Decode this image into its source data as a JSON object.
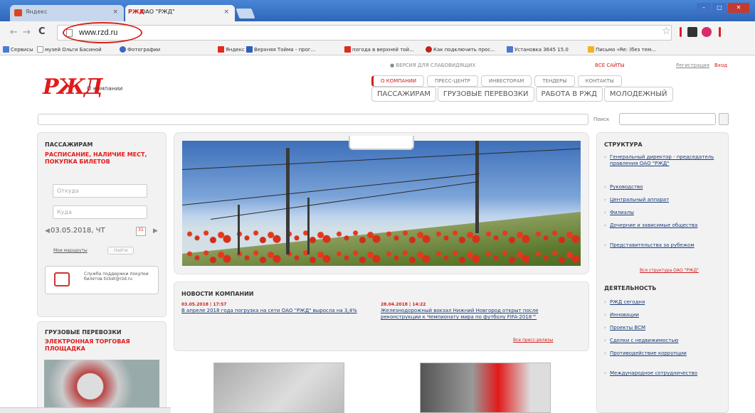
{
  "browser": {
    "tabs": [
      {
        "label": "Яндекс",
        "active": false
      },
      {
        "label": "ОАО \"РЖД\"",
        "favicon_text": "РЖД",
        "active": true
      }
    ],
    "close_glyph": "×",
    "address": "www.rzd.ru",
    "nav": {
      "back": "←",
      "forward": "→",
      "reload": "C"
    },
    "star_glyph": "☆",
    "window_buttons": [
      "–",
      "□",
      "✕"
    ],
    "bookmarks": [
      {
        "label": "Сервисы",
        "color": "#4a7bd0"
      },
      {
        "label": "музей Ольги Басиной",
        "color": "#7aa0d8"
      },
      {
        "label": "Фотографии",
        "color": "#3a67c4"
      },
      {
        "label": "Яндекс",
        "color": "#e02b1c"
      },
      {
        "label": "Верхняя Тойма - прог...",
        "color": "#2f5fb8"
      },
      {
        "label": "погода в верхней той...",
        "color": "#e02b1c"
      },
      {
        "label": "Как подключить прос...",
        "color": "#c4231b"
      },
      {
        "label": "Установка 3645 15.0",
        "color": "#4c79c9"
      },
      {
        "label": "Письмо «Re: (без тем...",
        "color": "#f0b323"
      }
    ]
  },
  "site": {
    "logo_text": "РЖД",
    "logo_subtitle": "О компании",
    "utility": {
      "accessible": "ВЕРСИЯ ДЛЯ СЛАБОВИДЯЩИХ",
      "all_sites": "ВСЕ САЙТЫ",
      "register": "Регистрация",
      "login": "Вход"
    },
    "top_nav": [
      "О КОМПАНИИ",
      "ПРЕСС-ЦЕНТР",
      "ИНВЕСТОРАМ",
      "ТЕНДЕРЫ",
      "КОНТАКТЫ"
    ],
    "main_nav": [
      "ПАССАЖИРАМ",
      "ГРУЗОВЫЕ ПЕРЕВОЗКИ",
      "РАБОТА В РЖД",
      "МОЛОДЕЖНЫЙ"
    ],
    "search_label": "Поиск",
    "passengers": {
      "heading": "ПАССАЖИРАМ",
      "subheading": "РАСПИСАНИЕ, НАЛИЧИЕ МЕСТ, ПОКУПКА БИЛЕТОВ",
      "from_placeholder": "Откуда",
      "to_placeholder": "Куда",
      "date": "03.05.2018, ЧТ",
      "cal_label": "31",
      "routes_link": "Мои маршруты",
      "find_button": "Найти",
      "support_text": "Служба поддержки покупки билетов ticket@rzd.ru"
    },
    "freight": {
      "heading": "ГРУЗОВЫЕ ПЕРЕВОЗКИ",
      "subheading": "ЭЛЕКТРОННАЯ ТОРГОВАЯ ПЛОЩАДКА"
    },
    "news": {
      "heading": "НОВОСТИ КОМПАНИИ",
      "items": [
        {
          "date": "03.05.2018 | 17:57",
          "title": "В апреле 2018 года погрузка на сети ОАО \"РЖД\" выросла на 3,4%"
        },
        {
          "date": "28.04.2018 | 14:22",
          "title": "Железнодорожный вокзал Нижний Новгород открыт после реконструкции к Чемпионату мира по футболу FIFA-2018™"
        }
      ],
      "all_link": "Все пресс-релизы"
    },
    "structure": {
      "heading": "СТРУКТУРА",
      "items": [
        "Генеральный директор - председатель правления ОАО \"РЖД\"",
        "Руководство",
        "Центральный аппарат",
        "Филиалы",
        "Дочерние и зависимые общества",
        "Представительства за рубежом"
      ],
      "all_link": "Вся структура ОАО \"РЖД\""
    },
    "activity": {
      "heading": "ДЕЯТЕЛЬНОСТЬ",
      "items": [
        "РЖД сегодня",
        "Инновации",
        "Проекты ВСМ",
        "Сделки с недвижимостью",
        "Противодействие коррупции",
        "Международное сотрудничество"
      ]
    }
  },
  "colors": {
    "brand_red": "#e21a1a",
    "link_blue": "#1a3c7a",
    "highlight_circle": "#d8231b"
  }
}
